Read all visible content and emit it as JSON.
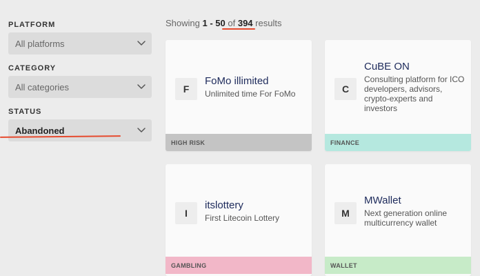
{
  "filters": {
    "platform": {
      "label": "PLATFORM",
      "value": "All platforms"
    },
    "category": {
      "label": "CATEGORY",
      "value": "All categories"
    },
    "status": {
      "label": "STATUS",
      "value": "Abandoned"
    }
  },
  "results": {
    "prefix": "Showing",
    "range": "1 - 50",
    "of": "of",
    "total": "394",
    "suffix": "results"
  },
  "cards": [
    {
      "initial": "F",
      "title": "FoMo illimited",
      "description": "Unlimited time For FoMo",
      "tag": "HIGH RISK",
      "tag_color": "#c4c4c4"
    },
    {
      "initial": "C",
      "title": "CuBE ON",
      "description": "Consulting platform for ICO developers, advisors, crypto-experts and investors",
      "tag": "FINANCE",
      "tag_color": "#b5e8df"
    },
    {
      "initial": "I",
      "title": "itslottery",
      "description": "First Litecoin Lottery",
      "tag": "GAMBLING",
      "tag_color": "#f2b7c8"
    },
    {
      "initial": "M",
      "title": "MWallet",
      "description": "Next generation online multicurrency wallet",
      "tag": "WALLET",
      "tag_color": "#c7ebc8"
    }
  ],
  "icons": {
    "select_chevron": "chevron-down-icon"
  },
  "colors": {
    "annotation_underline": "#e64a2e",
    "select_bg": "#dcdcdc",
    "title_text": "#1d2a5b"
  }
}
